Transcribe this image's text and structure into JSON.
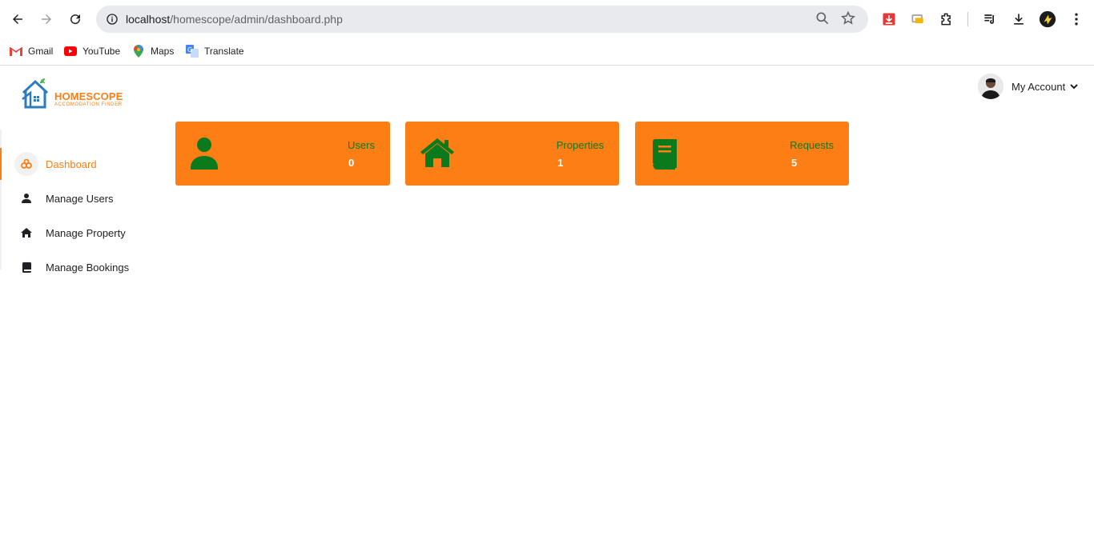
{
  "browser": {
    "url_host": "localhost",
    "url_path": "/homescope/admin/dashboard.php",
    "bookmarks": [
      "Gmail",
      "YouTube",
      "Maps",
      "Translate"
    ]
  },
  "app": {
    "logo_title": "HOMESCOPE",
    "logo_subtitle": "ACCOMODATION FINDER",
    "account_label": "My Account",
    "accent_color": "#fd7e14",
    "icon_color": "#0b7a1d"
  },
  "sidebar": {
    "items": [
      {
        "label": "Dashboard",
        "icon": "dashboard-icon"
      },
      {
        "label": "Manage Users",
        "icon": "user-icon"
      },
      {
        "label": "Manage Property",
        "icon": "home-icon"
      },
      {
        "label": "Manage Bookings",
        "icon": "book-icon"
      }
    ]
  },
  "cards": [
    {
      "label": "Users",
      "value": "0",
      "icon": "user-icon"
    },
    {
      "label": "Properties",
      "value": "1",
      "icon": "home-icon"
    },
    {
      "label": "Requests",
      "value": "5",
      "icon": "book-icon"
    }
  ]
}
